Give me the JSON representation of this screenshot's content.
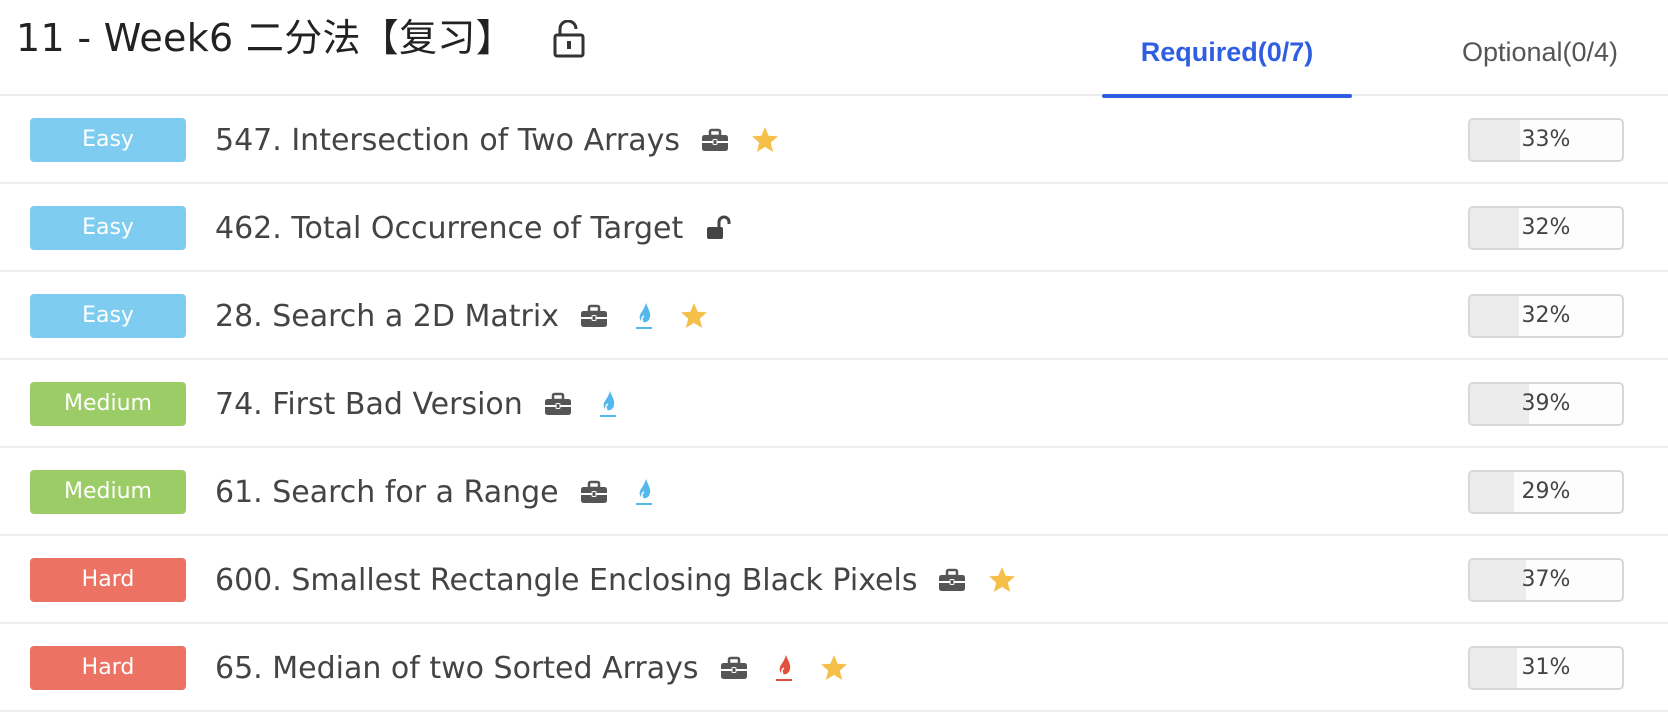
{
  "page": {
    "title": "11 - Week6 二分法【复习】",
    "title_icon": "unlock-icon"
  },
  "tabs": [
    {
      "label": "Required(0/7)",
      "active": true
    },
    {
      "label": "Optional(0/4)",
      "active": false
    }
  ],
  "colors": {
    "easy": "#7ecdf0",
    "medium": "#9ccc65",
    "hard": "#ec7263",
    "accent": "#2f5fe0",
    "star": "#f5c04a",
    "fire_blue": "#54b8ec",
    "fire_red": "#e0503c",
    "briefcase": "#555555"
  },
  "problems": [
    {
      "difficulty": "Easy",
      "name": "547. Intersection of Two Arrays",
      "acceptance": "33%",
      "acceptance_value": 0.33,
      "icons": [
        "briefcase-icon",
        "star-icon"
      ]
    },
    {
      "difficulty": "Easy",
      "name": "462. Total Occurrence of Target",
      "acceptance": "32%",
      "acceptance_value": 0.32,
      "icons": [
        "unlock-icon"
      ]
    },
    {
      "difficulty": "Easy",
      "name": "28. Search a 2D Matrix",
      "acceptance": "32%",
      "acceptance_value": 0.32,
      "icons": [
        "briefcase-icon",
        "fire-blue-icon",
        "star-icon"
      ]
    },
    {
      "difficulty": "Medium",
      "name": "74. First Bad Version",
      "acceptance": "39%",
      "acceptance_value": 0.39,
      "icons": [
        "briefcase-icon",
        "fire-blue-icon"
      ]
    },
    {
      "difficulty": "Medium",
      "name": "61. Search for a Range",
      "acceptance": "29%",
      "acceptance_value": 0.29,
      "icons": [
        "briefcase-icon",
        "fire-blue-icon"
      ]
    },
    {
      "difficulty": "Hard",
      "name": "600. Smallest Rectangle Enclosing Black Pixels",
      "acceptance": "37%",
      "acceptance_value": 0.37,
      "icons": [
        "briefcase-icon",
        "star-icon"
      ]
    },
    {
      "difficulty": "Hard",
      "name": "65. Median of two Sorted Arrays",
      "acceptance": "31%",
      "acceptance_value": 0.31,
      "icons": [
        "briefcase-icon",
        "fire-red-icon",
        "star-icon"
      ]
    }
  ]
}
